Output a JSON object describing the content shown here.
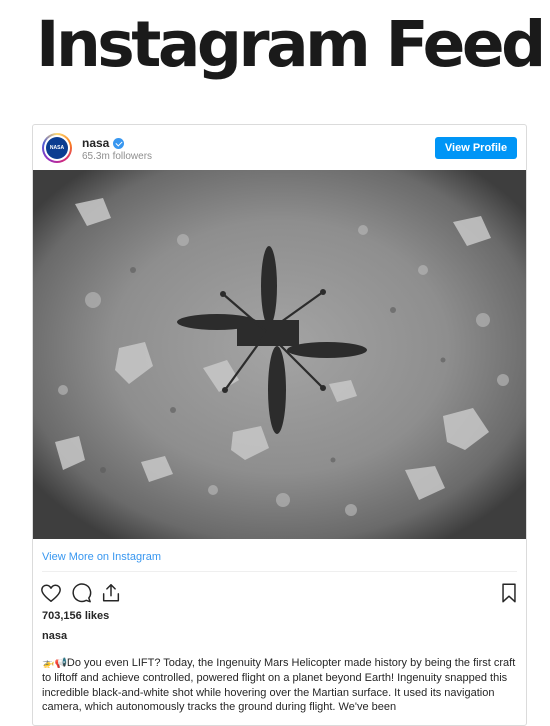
{
  "page": {
    "title": "Instagram Feed"
  },
  "post": {
    "username": "nasa",
    "followers": "65.3m followers",
    "view_profile_label": "View Profile",
    "avatar_text": "NASA",
    "view_more_label": "View More on Instagram",
    "likes": "703,156 likes",
    "author": "nasa",
    "caption_emoji": "🚁📢",
    "caption": "Do you even LIFT? Today, the Ingenuity Mars Helicopter made history by being the first craft to liftoff and achieve controlled, powered flight on a planet beyond Earth! Ingenuity snapped this incredible black-and-white shot while hovering over the Martian surface. It used its navigation camera, which autonomously tracks the ground during flight. We've been"
  },
  "icons": {
    "verified": "verified-badge-icon",
    "like": "heart-icon",
    "comment": "comment-icon",
    "share": "share-icon",
    "save": "bookmark-icon"
  },
  "colors": {
    "accent": "#0095f6",
    "link": "#3897f0",
    "border": "#dbdbdb",
    "muted": "#8e8e8e"
  }
}
